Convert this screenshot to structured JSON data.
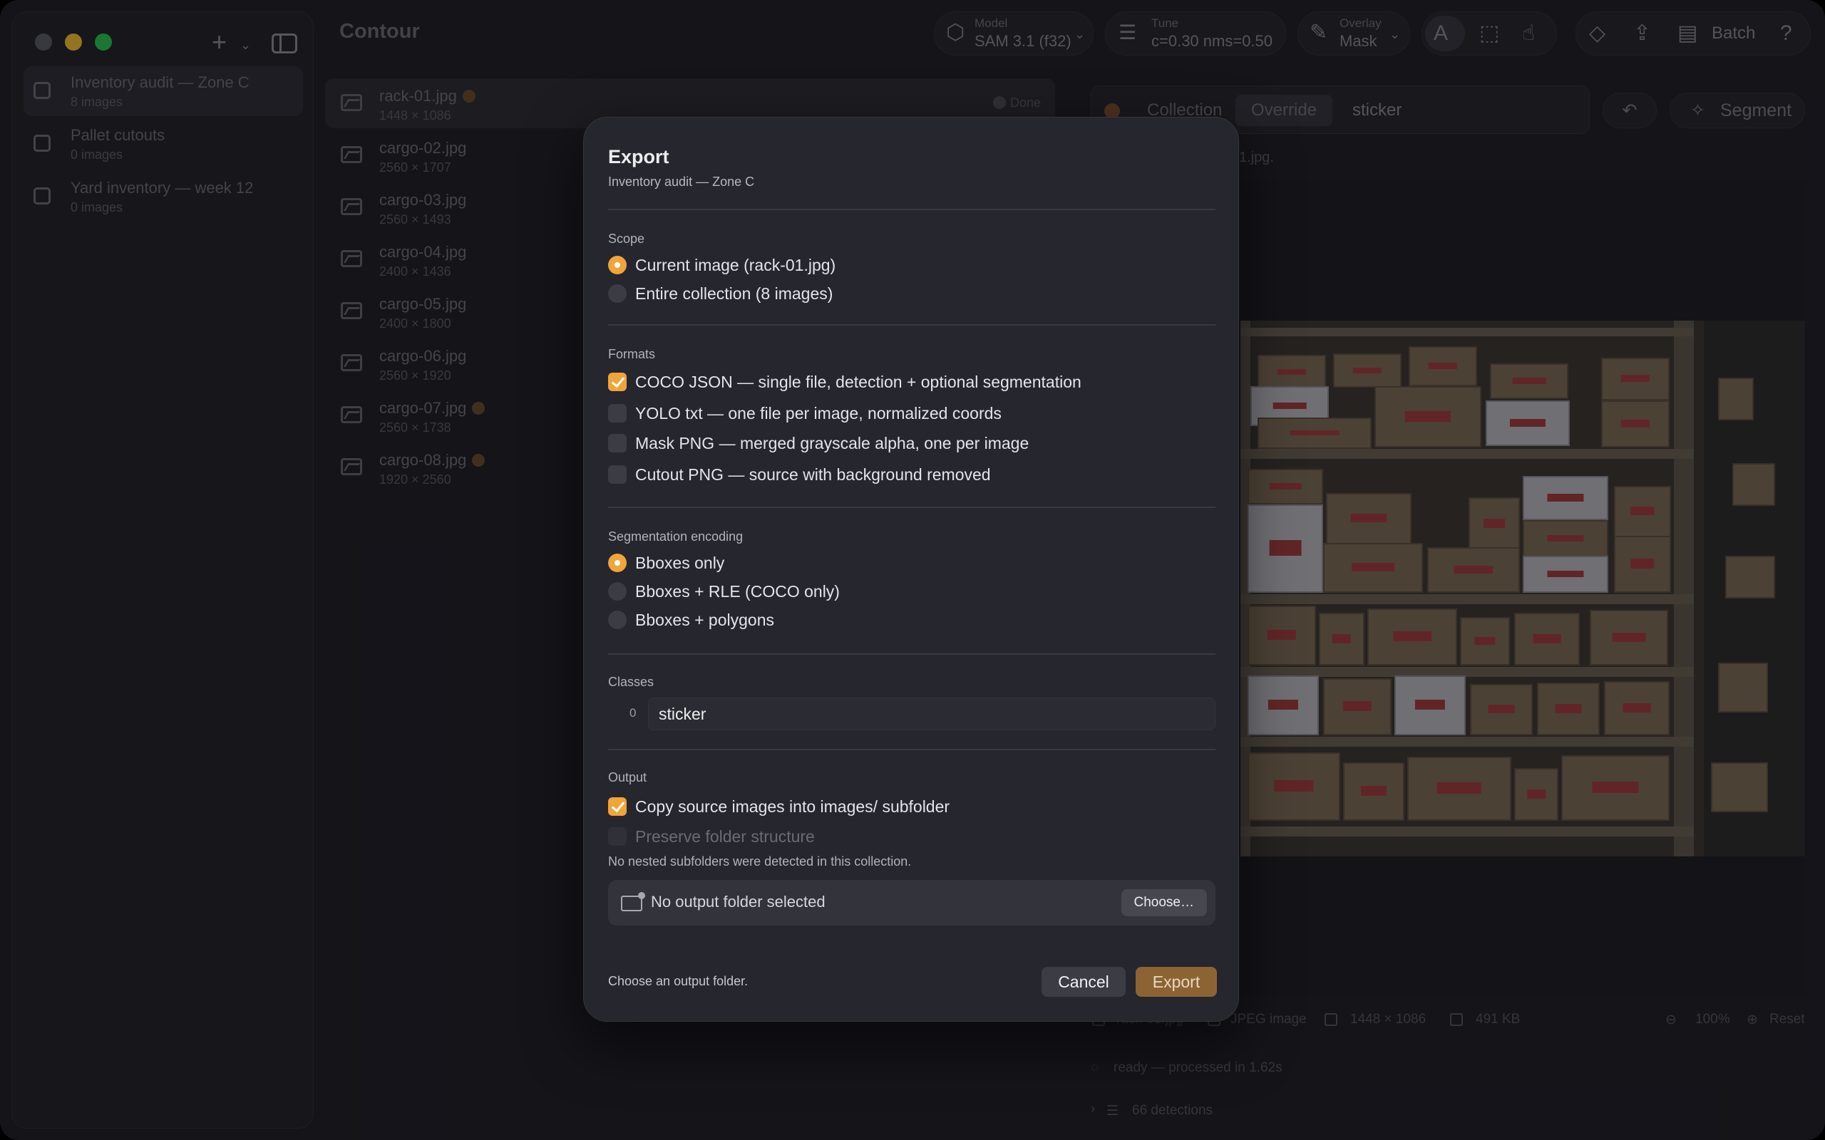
{
  "app": {
    "title": "Contour"
  },
  "sidebar": {
    "collections": [
      {
        "name": "Inventory audit — Zone C",
        "count": "8 images"
      },
      {
        "name": "Pallet cutouts",
        "count": "0 images"
      },
      {
        "name": "Yard inventory — week 12",
        "count": "0 images"
      }
    ]
  },
  "toolbar": {
    "model_label": "Model",
    "model_value": "SAM 3.1 (f32)",
    "tune_label": "Tune",
    "tune_value": "c=0.30 nms=0.50",
    "overlay_label": "Overlay",
    "overlay_value": "Mask",
    "batch_label": "Batch"
  },
  "files": [
    {
      "name": "rack-01.jpg",
      "dims": "1448 × 1086",
      "status": "Done"
    },
    {
      "name": "cargo-02.jpg",
      "dims": "2560 × 1707"
    },
    {
      "name": "cargo-03.jpg",
      "dims": "2560 × 1493"
    },
    {
      "name": "cargo-04.jpg",
      "dims": "2400 × 1436"
    },
    {
      "name": "cargo-05.jpg",
      "dims": "2400 × 1800"
    },
    {
      "name": "cargo-06.jpg",
      "dims": "2560 × 1920"
    },
    {
      "name": "cargo-07.jpg",
      "dims": "2560 × 1738"
    },
    {
      "name": "cargo-08.jpg",
      "dims": "1920 × 2560"
    }
  ],
  "right_panel": {
    "mode_collection": "Collection",
    "mode_override": "Override",
    "prompt_value": "sticker",
    "segment_label": "Segment",
    "note_fragment": "1.jpg.",
    "meta": {
      "filename": "rack-01.jpg",
      "type": "JPEG image",
      "dims": "1448 × 1086",
      "size": "491 KB",
      "zoom": "100%",
      "reset": "Reset"
    },
    "status": "ready — processed in 1.62s",
    "detections": "66 detections"
  },
  "modal": {
    "title": "Export",
    "subtitle": "Inventory audit — Zone C",
    "scope_label": "Scope",
    "scope_options": [
      "Current image (rack-01.jpg)",
      "Entire collection (8 images)"
    ],
    "formats_label": "Formats",
    "format_options": [
      "COCO JSON — single file, detection + optional segmentation",
      "YOLO txt — one file per image, normalized coords",
      "Mask PNG — merged grayscale alpha, one per image",
      "Cutout PNG — source with background removed"
    ],
    "encoding_label": "Segmentation encoding",
    "encoding_options": [
      "Bboxes only",
      "Bboxes + RLE (COCO only)",
      "Bboxes + polygons"
    ],
    "classes_label": "Classes",
    "class_index": "0",
    "class_value": "sticker",
    "output_label": "Output",
    "copy_option": "Copy source images into images/ subfolder",
    "preserve_option": "Preserve folder structure",
    "nested_hint": "No nested subfolders were detected in this collection.",
    "folder_text": "No output folder selected",
    "choose_label": "Choose…",
    "footer_note": "Choose an output folder.",
    "cancel_label": "Cancel",
    "export_label": "Export"
  }
}
